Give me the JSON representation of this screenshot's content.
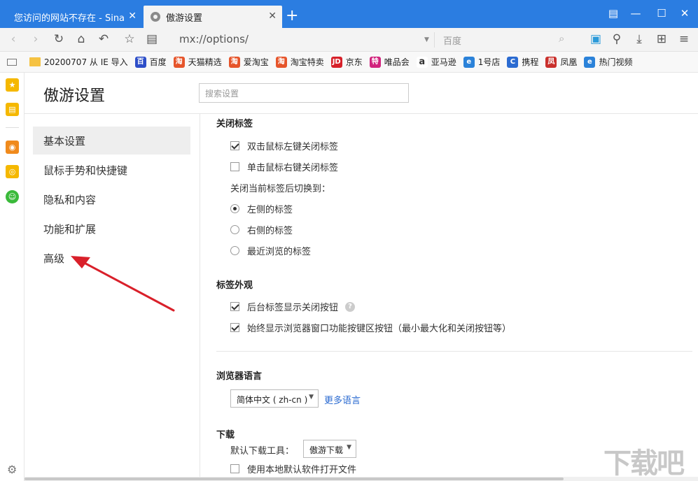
{
  "tabs": [
    {
      "label": "您访问的网站不存在 - Sina A"
    },
    {
      "label": "傲游设置"
    }
  ],
  "nav": {
    "address": "mx://options/",
    "search_placeholder": "百度"
  },
  "bookmarks": [
    {
      "label": "20200707 从 IE 导入",
      "icon": "folder-icon",
      "color": "#f5c242",
      "glyph": ""
    },
    {
      "label": "百度",
      "icon": "baidu-icon",
      "color": "#2d4ec8",
      "glyph": "百"
    },
    {
      "label": "天猫精选",
      "icon": "tmall-icon",
      "color": "#e6552b",
      "glyph": "淘"
    },
    {
      "label": "爱淘宝",
      "icon": "aitaobao-icon",
      "color": "#e6552b",
      "glyph": "淘"
    },
    {
      "label": "淘宝特卖",
      "icon": "taobao-icon",
      "color": "#e6552b",
      "glyph": "淘"
    },
    {
      "label": "京东",
      "icon": "jd-icon",
      "color": "#d7212a",
      "glyph": "JD"
    },
    {
      "label": "唯品会",
      "icon": "vip-icon",
      "color": "#d1237d",
      "glyph": "特"
    },
    {
      "label": "亚马逊",
      "icon": "amazon-icon",
      "color": "#333333",
      "glyph": "a"
    },
    {
      "label": "1号店",
      "icon": "ie-icon",
      "color": "#2b82d9",
      "glyph": "e"
    },
    {
      "label": "携程",
      "icon": "ctrip-icon",
      "color": "#2b6bd1",
      "glyph": "C"
    },
    {
      "label": "凤凰",
      "icon": "phoenix-icon",
      "color": "#c9302c",
      "glyph": "凤"
    },
    {
      "label": "热门视频",
      "icon": "ie-icon",
      "color": "#2b82d9",
      "glyph": "e"
    }
  ],
  "header": {
    "title": "傲游设置",
    "search_placeholder": "搜索设置"
  },
  "menu": [
    {
      "label": "基本设置",
      "active": true
    },
    {
      "label": "鼠标手势和快捷键",
      "active": false
    },
    {
      "label": "隐私和内容",
      "active": false
    },
    {
      "label": "功能和扩展",
      "active": false
    },
    {
      "label": "高级",
      "active": false
    }
  ],
  "close_tab": {
    "title": "关闭标签",
    "options": [
      {
        "label": "双击鼠标左键关闭标签",
        "checked": true
      },
      {
        "label": "单击鼠标右键关闭标签",
        "checked": false
      }
    ],
    "switch_label": "关闭当前标签后切换到：",
    "switch_options": [
      {
        "label": "左侧的标签",
        "selected": true
      },
      {
        "label": "右侧的标签",
        "selected": false
      },
      {
        "label": "最近浏览的标签",
        "selected": false
      }
    ]
  },
  "tab_appearance": {
    "title": "标签外观",
    "options": [
      {
        "label": "后台标签显示关闭按钮",
        "checked": true
      },
      {
        "label": "始终显示浏览器窗口功能按键区按钮（最小最大化和关闭按钮等）",
        "checked": true
      }
    ],
    "help_glyph": "?"
  },
  "language": {
    "title": "浏览器语言",
    "selected": "简体中文 ( zh-cn )",
    "more_link": "更多语言"
  },
  "download": {
    "title": "下载",
    "tool_label": "默认下载工具：",
    "tool_selected": "傲游下载",
    "open_local_label": "使用本地默认软件打开文件",
    "open_local_checked": false
  },
  "watermark": {
    "text": "下载吧"
  },
  "colors": {
    "titlebar": "#2b7de1",
    "arrow": "#d9202a",
    "link": "#2b6bd1"
  }
}
